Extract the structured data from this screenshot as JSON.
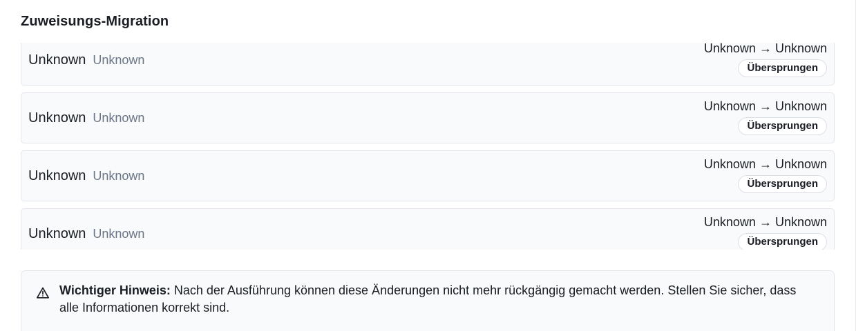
{
  "section": {
    "title": "Zuweisungs-Migration"
  },
  "rows": [
    {
      "name": "Unknown",
      "sub": "Unknown",
      "from": "Unknown",
      "arrow": "→",
      "to": "Unknown",
      "status": "Übersprungen"
    },
    {
      "name": "Unknown",
      "sub": "Unknown",
      "from": "Unknown",
      "arrow": "→",
      "to": "Unknown",
      "status": "Übersprungen"
    },
    {
      "name": "Unknown",
      "sub": "Unknown",
      "from": "Unknown",
      "arrow": "→",
      "to": "Unknown",
      "status": "Übersprungen"
    },
    {
      "name": "Unknown",
      "sub": "Unknown",
      "from": "Unknown",
      "arrow": "→",
      "to": "Unknown",
      "status": "Übersprungen"
    }
  ],
  "notice": {
    "icon": "warning-triangle-icon",
    "label": "Wichtiger Hinweis:",
    "text": " Nach der Ausführung können diese Änderungen nicht mehr rückgängig gemacht werden. Stellen Sie sicher, dass alle Informationen korrekt sind."
  }
}
